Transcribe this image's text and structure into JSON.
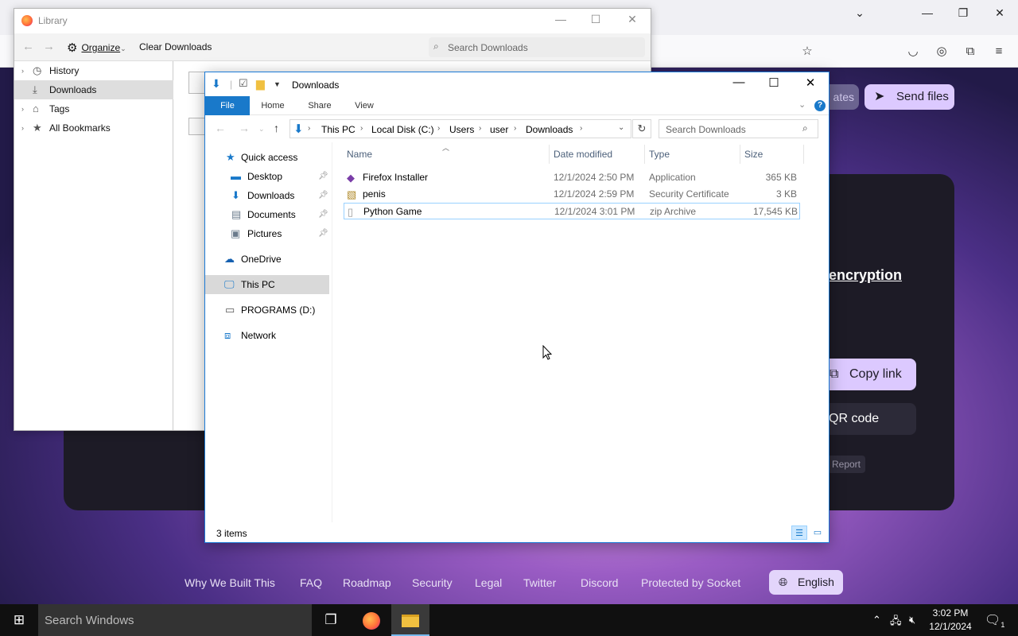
{
  "browser": {
    "winctl": {
      "minimize": "—",
      "maximize": "❐",
      "close": "✕",
      "tabs_dropdown": "⌄"
    },
    "toolbar_icons": {
      "bookmark": "☆",
      "pocket": "◡",
      "account": "◎",
      "extensions": "⧉",
      "menu": "≡"
    }
  },
  "site": {
    "updates_partial": "ates",
    "send_files": "Send files",
    "encryption_partial": "encryption",
    "copy_link": "Copy link",
    "qr_code_partial": "QR code",
    "report": "Report",
    "footer_links": [
      "Why We Built This",
      "FAQ",
      "Roadmap",
      "Security",
      "Legal",
      "Twitter",
      "Discord",
      "Protected by Socket"
    ],
    "language": "English"
  },
  "library": {
    "title": "Library",
    "organize": "Organize",
    "organize_caret": "⌄",
    "clear_downloads": "Clear Downloads",
    "search_placeholder": "Search Downloads",
    "sidebar": [
      {
        "label": "History",
        "icon": "clock-icon",
        "twisty": "›"
      },
      {
        "label": "Downloads",
        "icon": "download-icon",
        "twisty": ""
      },
      {
        "label": "Tags",
        "icon": "tag-icon",
        "twisty": "›"
      },
      {
        "label": "All Bookmarks",
        "icon": "star-icon",
        "twisty": "›"
      }
    ]
  },
  "explorer": {
    "title": "Downloads",
    "ribbon_tabs": [
      "File",
      "Home",
      "Share",
      "View"
    ],
    "help": "?",
    "breadcrumb": [
      "This PC",
      "Local Disk (C:)",
      "Users",
      "user",
      "Downloads"
    ],
    "crumb_separator": "›",
    "search_placeholder": "Search Downloads",
    "nav_pane": {
      "quick_access": "Quick access",
      "quick_items": [
        "Desktop",
        "Downloads",
        "Documents",
        "Pictures"
      ],
      "onedrive": "OneDrive",
      "this_pc": "This PC",
      "programs": "PROGRAMS (D:)",
      "network": "Network"
    },
    "columns": [
      "Name",
      "Date modified",
      "Type",
      "Size"
    ],
    "files": [
      {
        "name": "Firefox Installer",
        "date": "12/1/2024 2:50 PM",
        "type": "Application",
        "size": "365 KB",
        "icon": "installer-icon"
      },
      {
        "name": "penis",
        "date": "12/1/2024 2:59 PM",
        "type": "Security Certificate",
        "size": "3 KB",
        "icon": "certificate-icon"
      },
      {
        "name": "Python Game",
        "date": "12/1/2024 3:01 PM",
        "type": "zip Archive",
        "size": "17,545 KB",
        "icon": "file-icon"
      }
    ],
    "status": "3 items"
  },
  "taskbar": {
    "search_placeholder": "Search Windows",
    "time": "3:02 PM",
    "date": "12/1/2024",
    "notification_count": "1"
  },
  "colors": {
    "accent": "#1979ca",
    "site_button": "#dcc9ff",
    "taskbar": "#101010"
  }
}
